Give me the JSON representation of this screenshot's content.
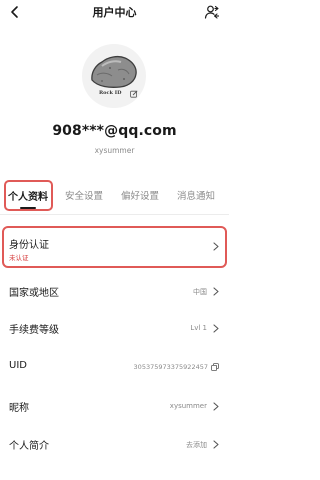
{
  "header": {
    "title": "用户中心",
    "back_icon": "chevron-left-icon",
    "action_icon": "user-switch-icon"
  },
  "profile": {
    "avatar_caption": "Rock ID",
    "email": "908***@qq.com",
    "username": "xysummer"
  },
  "tabs": [
    {
      "label": "个人资料",
      "active": true
    },
    {
      "label": "安全设置",
      "active": false
    },
    {
      "label": "偏好设置",
      "active": false
    },
    {
      "label": "消息通知",
      "active": false
    }
  ],
  "identity": {
    "label": "身份认证",
    "status": "未认证",
    "status_color": "#d63b3b"
  },
  "rows": {
    "country": {
      "label": "国家或地区",
      "value": "中国"
    },
    "fee_level": {
      "label": "手续费等级",
      "value": "Lvl 1"
    },
    "uid": {
      "label": "UID",
      "value": "305375973375922457"
    },
    "nickname": {
      "label": "昵称",
      "value": "xysummer"
    },
    "bio": {
      "label": "个人简介",
      "value": "去添加"
    }
  },
  "colors": {
    "highlight": "#e05a57",
    "muted": "#8a8a8a"
  }
}
